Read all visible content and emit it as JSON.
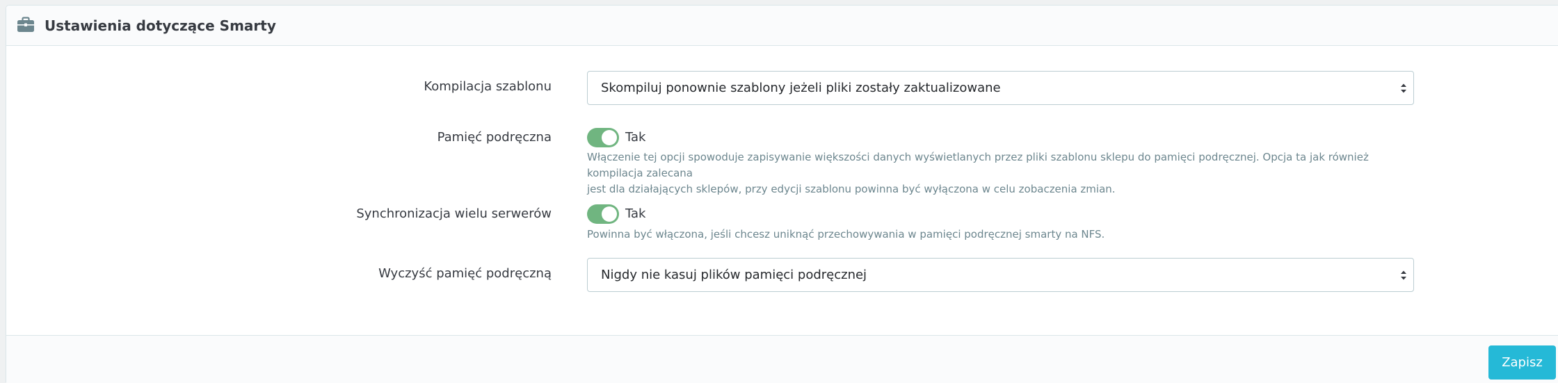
{
  "panel": {
    "title": "Ustawienia dotyczące Smarty",
    "icon": "briefcase-icon"
  },
  "fields": {
    "template_compilation": {
      "label": "Kompilacja szablonu",
      "value": "Skompiluj ponownie szablony jeżeli pliki zostały zaktualizowane"
    },
    "cache": {
      "label": "Pamięć podręczna",
      "state": "Tak",
      "enabled": true,
      "help_line1": "Włączenie tej opcji spowoduje zapisywanie większości danych wyświetlanych przez pliki szablonu sklepu do pamięci podręcznej. Opcja ta jak również kompilacja zalecana",
      "help_line2": "jest dla działających sklepów, przy edycji szablonu powinna być wyłączona w celu zobaczenia zmian."
    },
    "multi_server_sync": {
      "label": "Synchronizacja wielu serwerów",
      "state": "Tak",
      "enabled": true,
      "help": "Powinna być włączona, jeśli chcesz uniknąć przechowywania w pamięci podręcznej smarty na NFS."
    },
    "clear_cache": {
      "label": "Wyczyść pamięć podręczną",
      "value": "Nigdy nie kasuj plików pamięci podręcznej"
    }
  },
  "footer": {
    "save_label": "Zapisz"
  },
  "colors": {
    "toggle_on": "#70b580",
    "save_button": "#25b9d7",
    "help_text": "#6c868e",
    "label_text": "#363a41"
  }
}
